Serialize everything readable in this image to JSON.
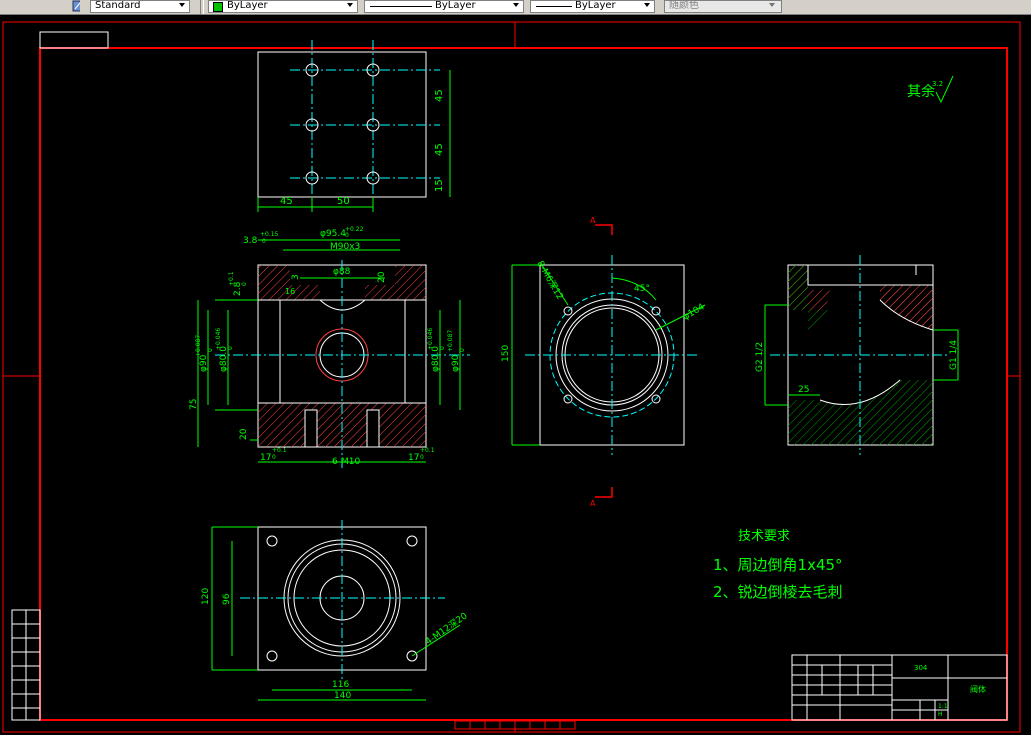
{
  "toolbar": {
    "text_style": "Standard",
    "color": "ByLayer",
    "linetype": "ByLayer",
    "lineweight": "ByLayer",
    "plot_style": "随颜色",
    "color_swatch": "#00c000"
  },
  "drawing": {
    "colors": {
      "border": "#ff0000",
      "outline": "#ffffff",
      "center": "#00ffff",
      "dimension": "#00ff00",
      "hatch": "#ff4040",
      "side_hatch": "#00a000"
    },
    "top_view": {
      "dims": [
        "45",
        "45",
        "15",
        "45",
        "50"
      ]
    },
    "front_view": {
      "dims": [
        "3.8",
        "+0.15",
        "0",
        "φ95.4",
        "+0.22",
        "0",
        "M90x3",
        "3",
        "φ88",
        "20",
        "2.8",
        "+0.1",
        "0",
        "16",
        "φ90",
        "+0.087",
        "0",
        "φ80.0",
        "+0.046",
        "0",
        "φ80.0",
        "+0.046",
        "0",
        "φ90",
        "+0.087",
        "0",
        "75",
        "20",
        "17",
        "+0.1",
        "0",
        "6-M10",
        "17",
        "+0.1",
        "0"
      ]
    },
    "section_view": {
      "dims": [
        "8-M6深12",
        "45°",
        "φ104",
        "150"
      ],
      "section_marks": [
        "A",
        "A"
      ]
    },
    "side_view": {
      "dims": [
        "G2 1/2",
        "G1 1/4",
        "25"
      ]
    },
    "bottom_view": {
      "dims": [
        "120",
        "96",
        "116",
        "140",
        "4-M12深20"
      ]
    },
    "roughness": {
      "label": "其余",
      "value": "3.2"
    },
    "notes": {
      "title": "技术要求",
      "items": [
        "1、周边倒角1x45°",
        "2、锐边倒棱去毛刺"
      ]
    },
    "title_block": {
      "material": "304",
      "drawing_name": "阀体",
      "scale": "1:1",
      "sheet": "H"
    }
  }
}
